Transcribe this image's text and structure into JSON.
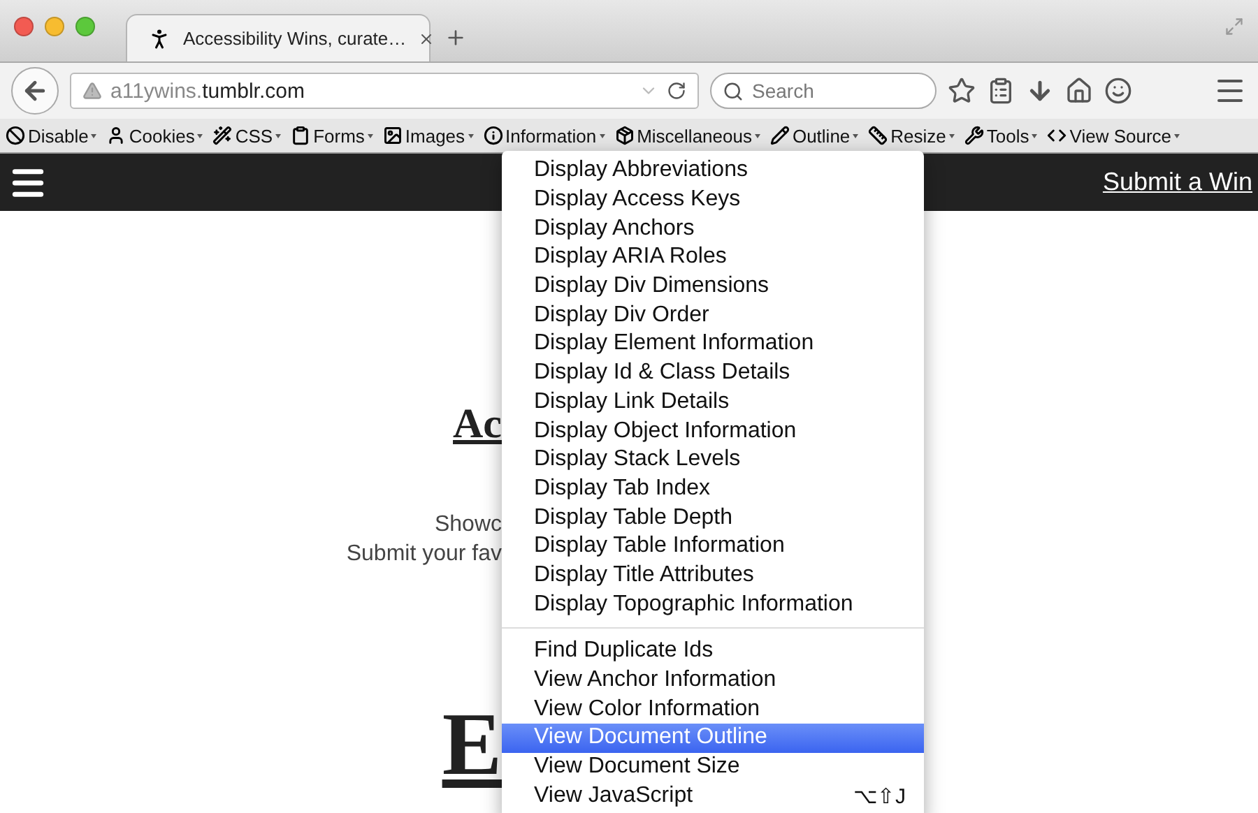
{
  "tabs": [
    {
      "title": "Accessibility Wins, curate…",
      "selected": true
    }
  ],
  "address": {
    "subdomain": "a11ywins.",
    "domain": "tumblr.com"
  },
  "search": {
    "placeholder": "Search"
  },
  "dev_toolbar": [
    "Disable",
    "Cookies",
    "CSS",
    "Forms",
    "Images",
    "Information",
    "Miscellaneous",
    "Outline",
    "Resize",
    "Tools",
    "View Source"
  ],
  "page": {
    "header_link": "Submit a Win",
    "heading": "Ac",
    "lines": [
      "Showc",
      "Submit your fav"
    ],
    "heading_2": "E"
  },
  "menu": {
    "groups": [
      [
        {
          "label": "Display Abbreviations",
          "selected": false
        },
        {
          "label": "Display Access Keys",
          "selected": false
        },
        {
          "label": "Display Anchors",
          "selected": false
        },
        {
          "label": "Display ARIA Roles",
          "selected": false
        },
        {
          "label": "Display Div Dimensions",
          "selected": false
        },
        {
          "label": "Display Div Order",
          "selected": false
        },
        {
          "label": "Display Element Information",
          "selected": false
        },
        {
          "label": "Display Id & Class Details",
          "selected": false
        },
        {
          "label": "Display Link Details",
          "selected": false
        },
        {
          "label": "Display Object Information",
          "selected": false
        },
        {
          "label": "Display Stack Levels",
          "selected": false
        },
        {
          "label": "Display Tab Index",
          "selected": false
        },
        {
          "label": "Display Table Depth",
          "selected": false
        },
        {
          "label": "Display Table Information",
          "selected": false
        },
        {
          "label": "Display Title Attributes",
          "selected": false
        },
        {
          "label": "Display Topographic Information",
          "selected": false
        }
      ],
      [
        {
          "label": "Find Duplicate Ids",
          "selected": false
        },
        {
          "label": "View Anchor Information",
          "selected": false
        },
        {
          "label": "View Color Information",
          "selected": false
        },
        {
          "label": "View Document Outline",
          "selected": true
        },
        {
          "label": "View Document Size",
          "selected": false
        },
        {
          "label": "View JavaScript",
          "selected": false,
          "shortcut": "⌥⇧J"
        }
      ]
    ]
  }
}
